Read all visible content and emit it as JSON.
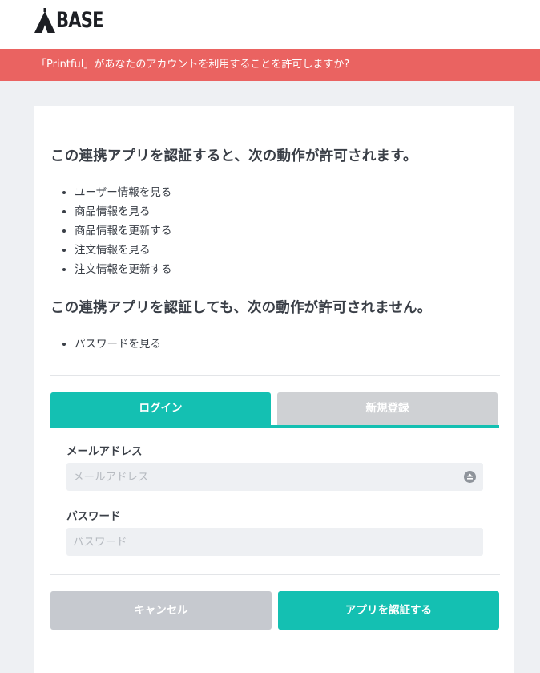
{
  "header": {
    "logo_text": "BASE"
  },
  "banner": {
    "text": "「Printful」があなたのアカウントを利用することを許可しますか?"
  },
  "permissions": {
    "allowed_heading": "この連携アプリを認証すると、次の動作が許可されます。",
    "allowed": [
      "ユーザー情報を見る",
      "商品情報を見る",
      "商品情報を更新する",
      "注文情報を見る",
      "注文情報を更新する"
    ],
    "denied_heading": "この連携アプリを認証しても、次の動作が許可されません。",
    "denied": [
      "パスワードを見る"
    ]
  },
  "tabs": {
    "login": "ログイン",
    "signup": "新規登録"
  },
  "form": {
    "email_label": "メールアドレス",
    "email_placeholder": "メールアドレス",
    "password_label": "パスワード",
    "password_placeholder": "パスワード"
  },
  "buttons": {
    "cancel": "キャンセル",
    "authorize": "アプリを認証する"
  },
  "colors": {
    "brand": "#14c0b2",
    "banner": "#ea6361",
    "cancel": "#c6c9cf",
    "inactive_tab": "#cfd1d4"
  }
}
